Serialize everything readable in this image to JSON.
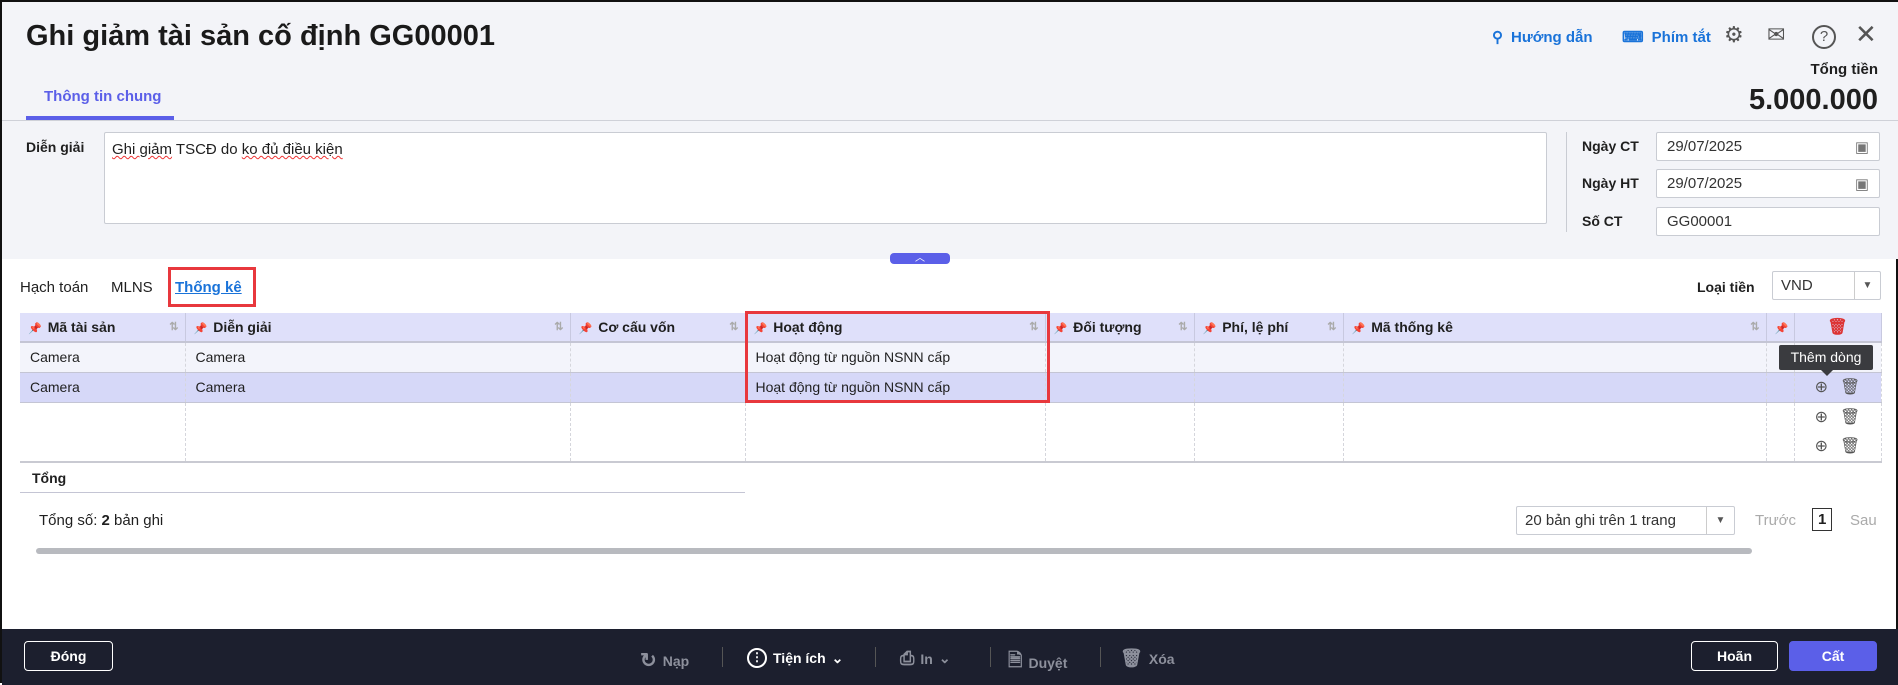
{
  "header": {
    "title": "Ghi giảm tài sản cố định GG00001",
    "guide": "Hướng dẫn",
    "shortcuts": "Phím tắt",
    "total_label": "Tổng tiền",
    "total_value": "5.000.000"
  },
  "tabs": {
    "main": "Thông tin chung"
  },
  "form": {
    "desc_label": "Diễn giải",
    "desc_value_parts": [
      "Ghi giảm",
      " TSCĐ do ",
      "ko đủ điều kiện"
    ],
    "ngay_ct_label": "Ngày CT",
    "ngay_ct": "29/07/2025",
    "ngay_ht_label": "Ngày HT",
    "ngay_ht": "29/07/2025",
    "so_ct_label": "Số CT",
    "so_ct": "GG00001"
  },
  "subtabs": [
    "Hạch toán",
    "MLNS",
    "Thống kê"
  ],
  "currency": {
    "label": "Loại tiền",
    "value": "VND"
  },
  "table": {
    "columns": [
      "Mã tài sản",
      "Diễn giải",
      "Cơ cấu vốn",
      "Hoạt động",
      "Đối tượng",
      "Phí, lệ phí",
      "Mã thống kê"
    ],
    "rows": [
      [
        "Camera",
        "Camera",
        "",
        "Hoạt động từ nguồn NSNN cấp",
        "",
        "",
        ""
      ],
      [
        "Camera",
        "Camera",
        "",
        "Hoạt động từ nguồn NSNN cấp",
        "",
        "",
        ""
      ]
    ],
    "total_label": "Tổng",
    "tooltip": "Thêm dòng"
  },
  "pager": {
    "count_prefix": "Tổng số: ",
    "count": "2",
    "count_suffix": " bản ghi",
    "page_size": "20 bản ghi trên 1 trang",
    "prev": "Trước",
    "page": "1",
    "next": "Sau"
  },
  "footer": {
    "close": "Đóng",
    "reload": "Nạp",
    "utilities": "Tiện ích",
    "print": "In",
    "approve": "Duyệt",
    "delete": "Xóa",
    "defer": "Hoãn",
    "save": "Cất"
  },
  "colors": {
    "accent": "#5b5fe8",
    "link": "#1a73d9",
    "highlight": "#e8383d",
    "footer": "#1c1f2e"
  }
}
